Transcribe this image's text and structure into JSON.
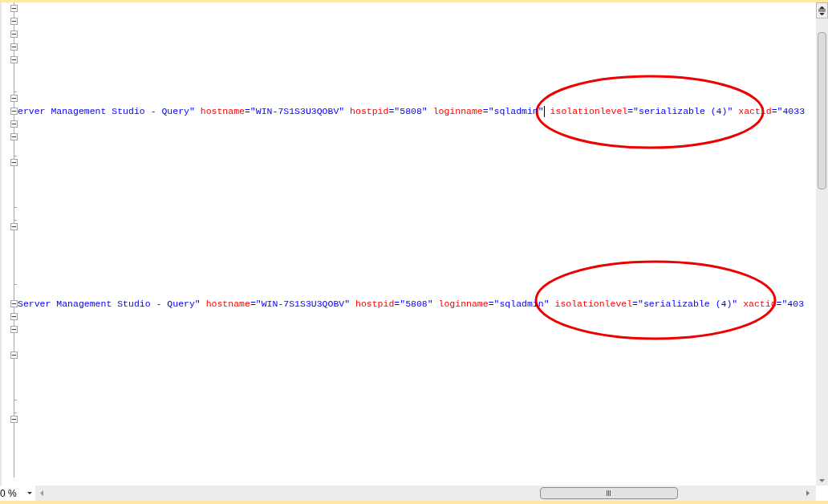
{
  "editor": {
    "lines": [
      {
        "kind": "open"
      },
      {
        "kind": "open"
      },
      {
        "kind": "open"
      },
      {
        "kind": "open"
      },
      {
        "kind": "open"
      },
      {
        "kind": "plain"
      },
      {
        "kind": "end"
      },
      {
        "kind": "open"
      },
      {
        "kind": "open",
        "tokens": [
          {
            "kind": "value",
            "text": "erver Management Studio - Query\""
          },
          {
            "kind": "attr",
            "text": " hostname"
          },
          {
            "kind": "value",
            "text": "=\"WIN-7S1S3U3QOBV\""
          },
          {
            "kind": "attr",
            "text": " hostpid"
          },
          {
            "kind": "value",
            "text": "=\"5808\""
          },
          {
            "kind": "attr",
            "text": " loginname"
          },
          {
            "kind": "value",
            "text": "=\"sqladmin\"",
            "cursor": true
          },
          {
            "kind": "attr",
            "text": " isolationlevel"
          },
          {
            "kind": "value",
            "text": "=\"serializable (4)\""
          },
          {
            "kind": "attr",
            "text": " xactid"
          },
          {
            "kind": "value",
            "text": "=\"4033"
          }
        ]
      },
      {
        "kind": "open"
      },
      {
        "kind": "open"
      },
      {
        "kind": "end"
      },
      {
        "kind": "open"
      },
      {
        "kind": "plain"
      },
      {
        "kind": "plain"
      },
      {
        "kind": "end"
      },
      {
        "kind": "end"
      },
      {
        "kind": "open"
      },
      {
        "kind": "plain"
      },
      {
        "kind": "plain"
      },
      {
        "kind": "plain"
      },
      {
        "kind": "end"
      },
      {
        "kind": "plain"
      },
      {
        "kind": "open",
        "tokens": [
          {
            "kind": "value",
            "text": "Server Management Studio - Query\""
          },
          {
            "kind": "attr",
            "text": " hostname"
          },
          {
            "kind": "value",
            "text": "=\"WIN-7S1S3U3QOBV\""
          },
          {
            "kind": "attr",
            "text": " hostpid"
          },
          {
            "kind": "value",
            "text": "=\"5808\""
          },
          {
            "kind": "attr",
            "text": " loginname"
          },
          {
            "kind": "value",
            "text": "=\"sqladmin\""
          },
          {
            "kind": "attr",
            "text": " isolationlevel"
          },
          {
            "kind": "value",
            "text": "=\"serializable (4)\""
          },
          {
            "kind": "attr",
            "text": " xactid"
          },
          {
            "kind": "value",
            "text": "=\"403"
          }
        ]
      },
      {
        "kind": "open"
      },
      {
        "kind": "open"
      },
      {
        "kind": "plain"
      },
      {
        "kind": "open"
      },
      {
        "kind": "plain"
      },
      {
        "kind": "plain"
      },
      {
        "kind": "end"
      },
      {
        "kind": "end"
      },
      {
        "kind": "open"
      },
      {
        "kind": "plain"
      },
      {
        "kind": "plain"
      },
      {
        "kind": "plain"
      },
      {
        "kind": "plain"
      }
    ]
  },
  "zoom": {
    "value": "0 %"
  }
}
